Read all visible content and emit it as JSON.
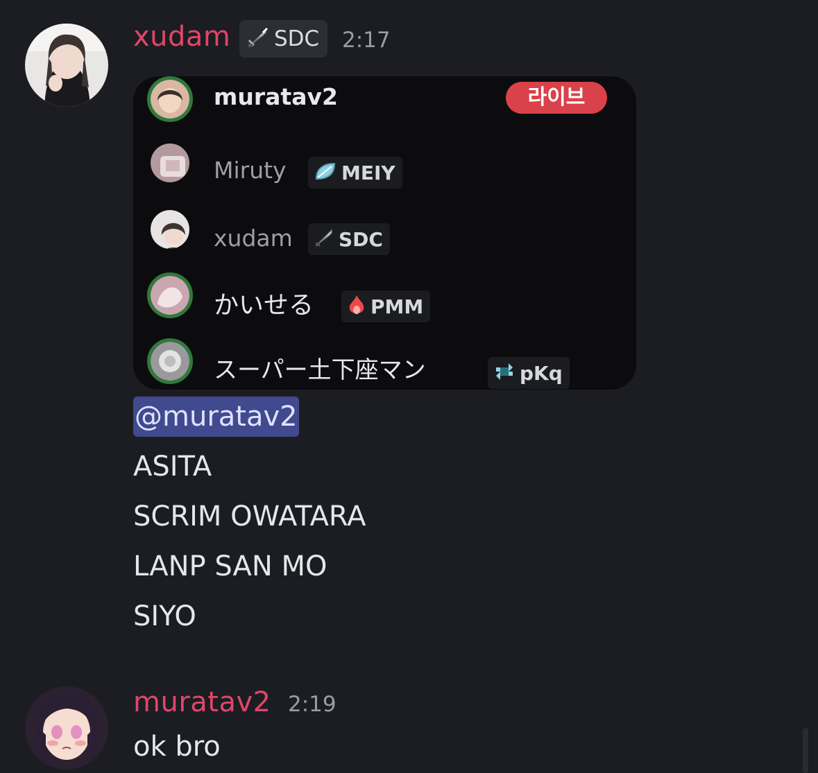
{
  "messages": [
    {
      "author": "xudam",
      "author_color": "#e0466a",
      "tag": {
        "icon": "sword-icon",
        "text": "SDC"
      },
      "time": "2:17",
      "embed": {
        "rows": [
          {
            "name": "muratav2",
            "live_badge": "라이브",
            "tag": null
          },
          {
            "name": "Miruty",
            "tag": {
              "icon": "leaf-icon",
              "text": "MEIY"
            }
          },
          {
            "name": "xudam",
            "tag": {
              "icon": "sword-icon",
              "text": "SDC"
            }
          },
          {
            "name": "かいせる",
            "tag": {
              "icon": "fire-icon",
              "text": "PMM"
            }
          },
          {
            "name": "スーパー土下座マン",
            "tag": {
              "icon": "knot-icon",
              "text": "pKq"
            }
          }
        ]
      },
      "mention": "@muratav2",
      "lines": [
        "ASITA",
        "SCRIM OWATARA",
        "LANP SAN MO",
        "SIYO"
      ]
    },
    {
      "author": "muratav2",
      "author_color": "#e0466a",
      "time": "2:19",
      "lines": [
        "ok bro"
      ]
    }
  ],
  "colors": {
    "background": "#1c1d22",
    "mention_bg": "#414a8e",
    "live_badge": "#d9424a"
  }
}
